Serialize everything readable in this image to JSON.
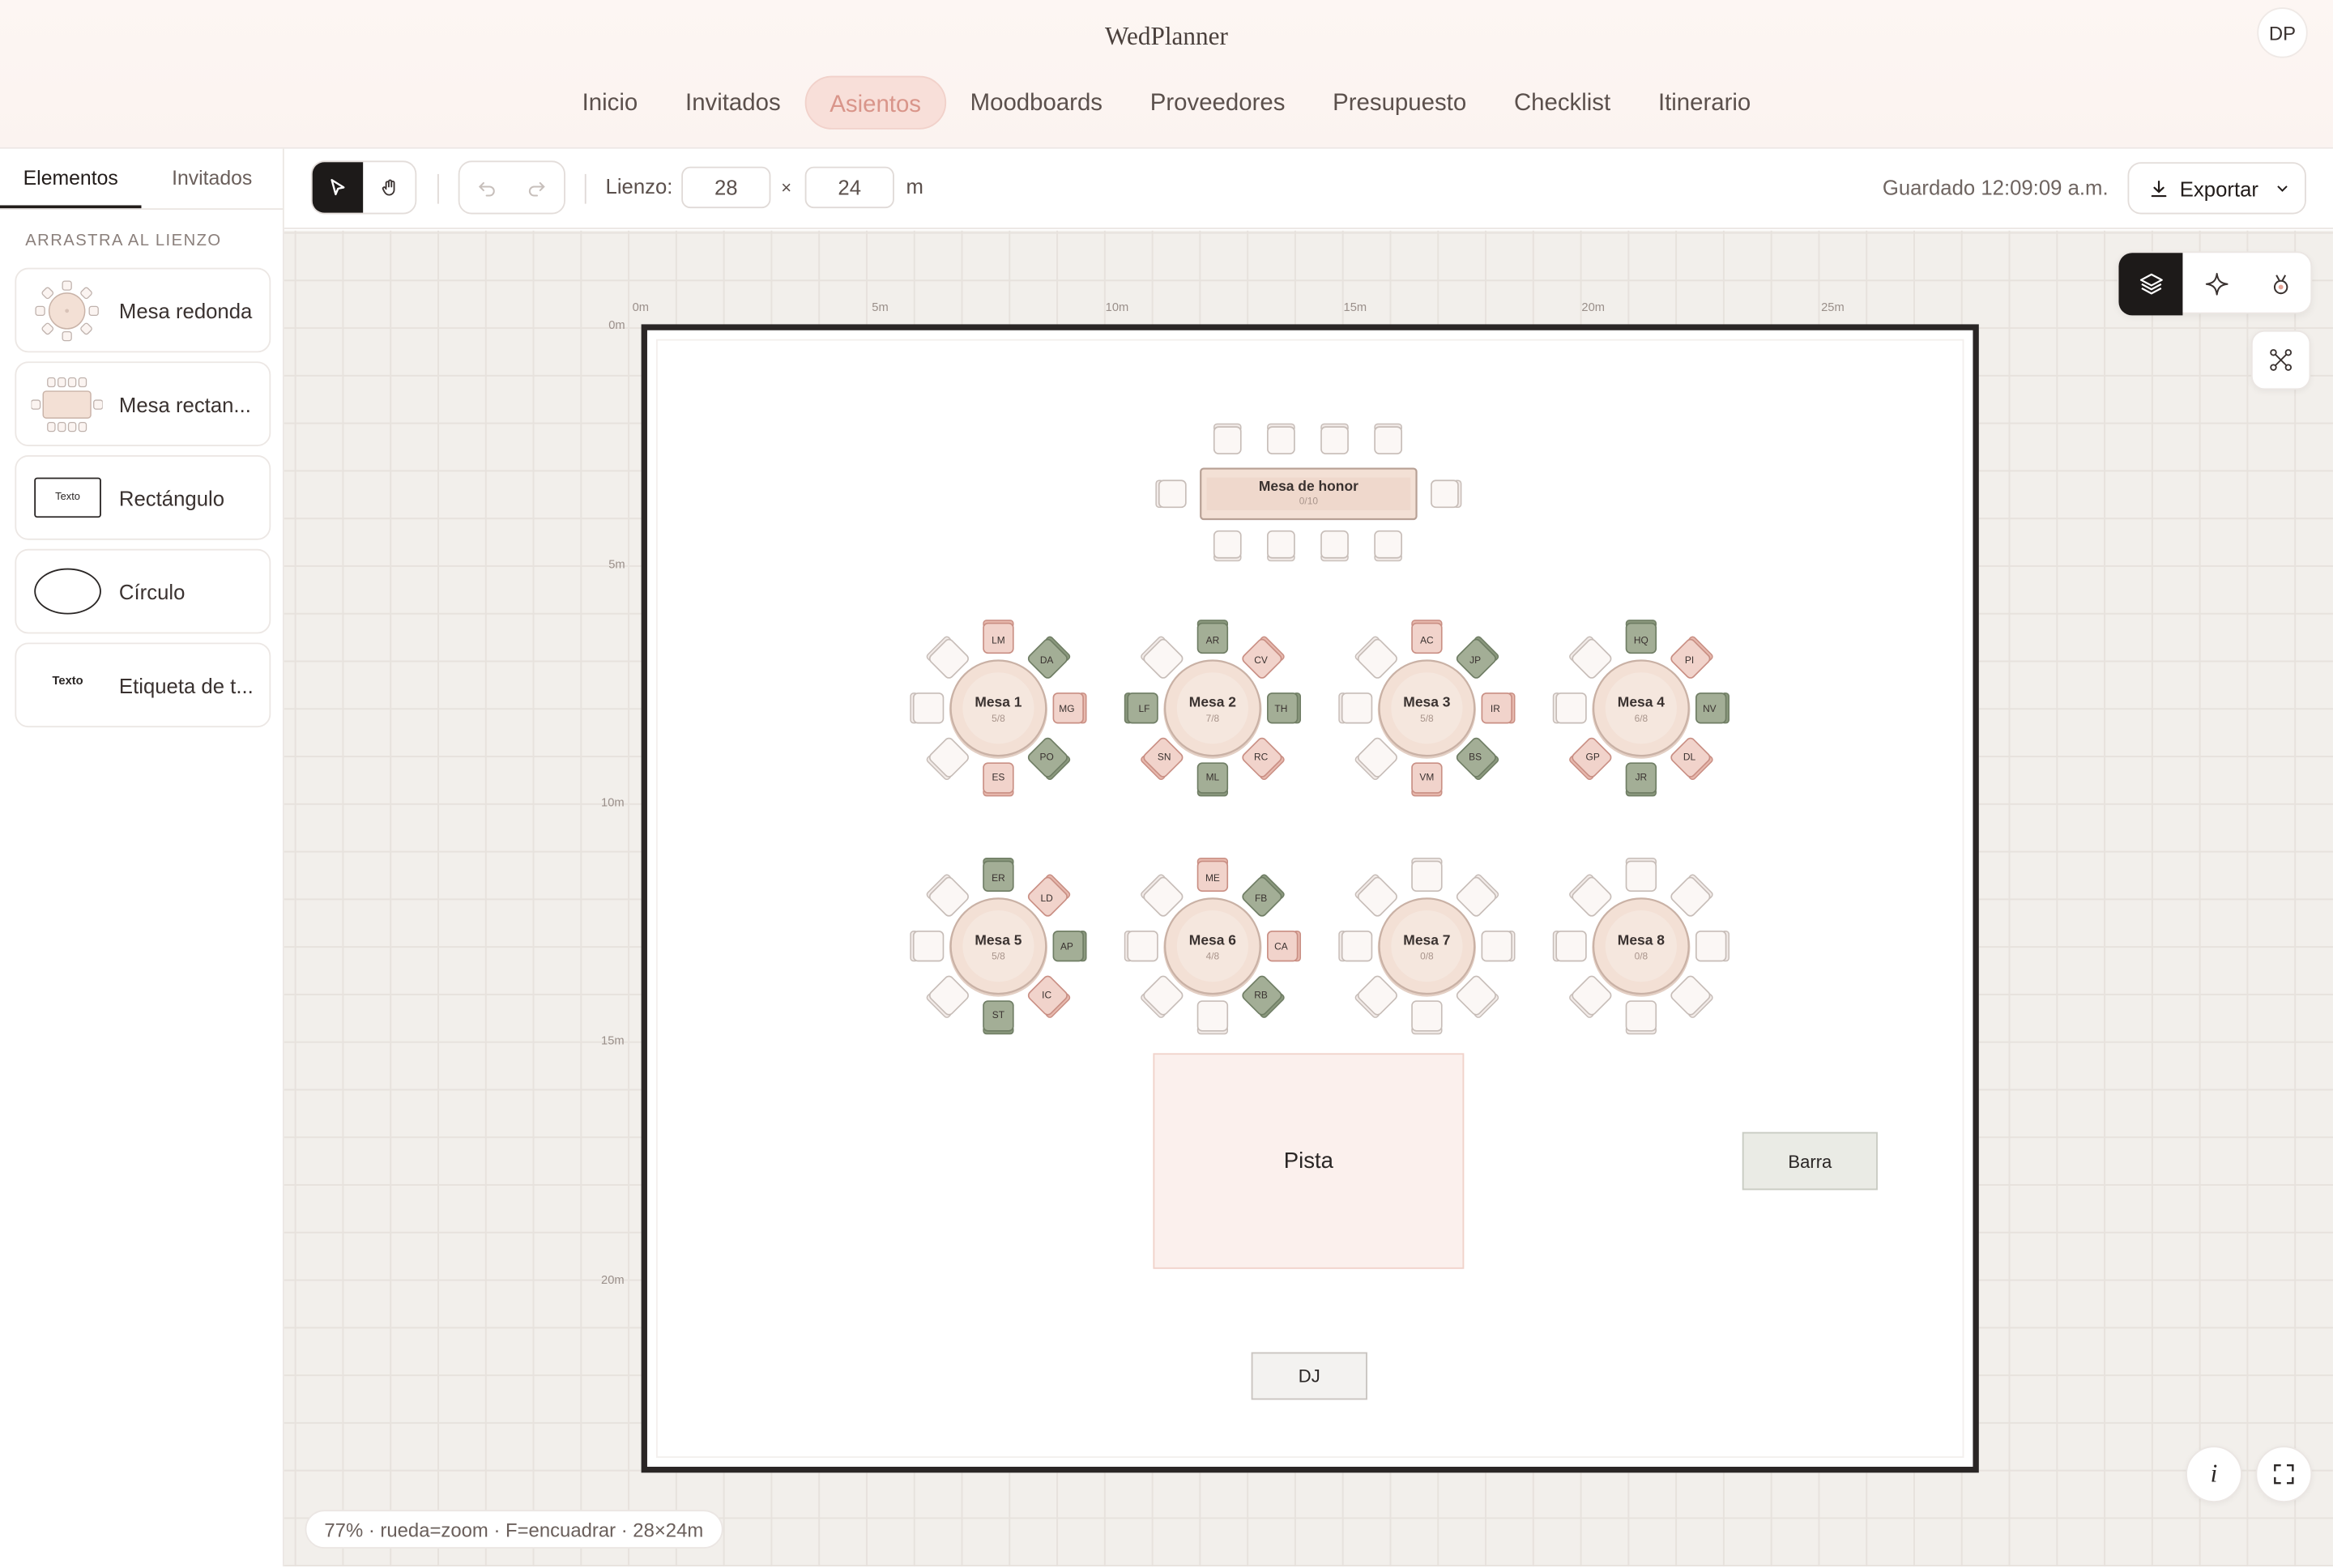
{
  "app": {
    "brand": "WedPlanner",
    "user_initials": "DP"
  },
  "nav": [
    {
      "label": "Inicio"
    },
    {
      "label": "Invitados"
    },
    {
      "label": "Asientos",
      "active": true
    },
    {
      "label": "Moodboards"
    },
    {
      "label": "Proveedores"
    },
    {
      "label": "Presupuesto"
    },
    {
      "label": "Checklist"
    },
    {
      "label": "Itinerario"
    }
  ],
  "sidebar": {
    "tabs": [
      {
        "label": "Elementos",
        "active": true
      },
      {
        "label": "Invitados"
      }
    ],
    "section_title": "ARRASTRA AL LIENZO",
    "items": [
      {
        "label": "Mesa redonda",
        "icon": "round-table-icon"
      },
      {
        "label": "Mesa rectan...",
        "icon": "rect-table-icon"
      },
      {
        "label": "Rectángulo",
        "icon": "rectangle-icon",
        "icon_text": "Texto"
      },
      {
        "label": "Círculo",
        "icon": "circle-shape-icon"
      },
      {
        "label": "Etiqueta de t...",
        "icon": "text-label-icon",
        "icon_text": "Texto"
      }
    ]
  },
  "toolbar": {
    "canvas_label": "Lienzo:",
    "width": "28",
    "times": "×",
    "height": "24",
    "unit": "m",
    "saved": "Guardado 12:09:09 a.m.",
    "export_label": "Exportar"
  },
  "rulers": {
    "x": [
      "0m",
      "5m",
      "10m",
      "15m",
      "20m",
      "25m"
    ],
    "y": [
      "0m",
      "5m",
      "10m",
      "15m",
      "20m"
    ]
  },
  "floorplan": {
    "head_table": {
      "name": "Mesa de honor",
      "count": "0/10"
    },
    "tables": [
      {
        "name": "Mesa 1",
        "count": "5/8",
        "seats": [
          "LM",
          "DA",
          "MG",
          "PO",
          "ES",
          "",
          "",
          ""
        ],
        "colors": [
          "p",
          "g",
          "p",
          "g",
          "p",
          "e",
          "e",
          "e"
        ]
      },
      {
        "name": "Mesa 2",
        "count": "7/8",
        "seats": [
          "AR",
          "CV",
          "TH",
          "RC",
          "ML",
          "SN",
          "LF",
          ""
        ],
        "colors": [
          "g",
          "p",
          "g",
          "p",
          "g",
          "p",
          "g",
          "e"
        ]
      },
      {
        "name": "Mesa 3",
        "count": "5/8",
        "seats": [
          "AC",
          "JP",
          "IR",
          "BS",
          "VM",
          "",
          "",
          ""
        ],
        "colors": [
          "p",
          "g",
          "p",
          "g",
          "p",
          "e",
          "e",
          "e"
        ]
      },
      {
        "name": "Mesa 4",
        "count": "6/8",
        "seats": [
          "HQ",
          "PI",
          "NV",
          "DL",
          "JR",
          "GP",
          "",
          ""
        ],
        "colors": [
          "g",
          "p",
          "g",
          "p",
          "g",
          "p",
          "e",
          "e"
        ]
      },
      {
        "name": "Mesa 5",
        "count": "5/8",
        "seats": [
          "ER",
          "LD",
          "AP",
          "IC",
          "ST",
          "",
          "",
          ""
        ],
        "colors": [
          "g",
          "p",
          "g",
          "p",
          "g",
          "e",
          "e",
          "e"
        ]
      },
      {
        "name": "Mesa 6",
        "count": "4/8",
        "seats": [
          "ME",
          "FB",
          "CA",
          "RB",
          "",
          "",
          "",
          ""
        ],
        "colors": [
          "p",
          "g",
          "p",
          "g",
          "e",
          "e",
          "e",
          "e"
        ]
      },
      {
        "name": "Mesa 7",
        "count": "0/8",
        "seats": [
          "",
          "",
          "",
          "",
          "",
          "",
          "",
          ""
        ],
        "colors": [
          "e",
          "e",
          "e",
          "e",
          "e",
          "e",
          "e",
          "e"
        ]
      },
      {
        "name": "Mesa 8",
        "count": "0/8",
        "seats": [
          "",
          "",
          "",
          "",
          "",
          "",
          "",
          ""
        ],
        "colors": [
          "e",
          "e",
          "e",
          "e",
          "e",
          "e",
          "e",
          "e"
        ]
      }
    ],
    "dance_floor": "Pista",
    "bar": "Barra",
    "dj": "DJ"
  },
  "colors": {
    "accent": "#d9958a",
    "seat_pink": "#f1d3cb",
    "seat_green": "#a3ae96",
    "table_fill": "#f3e0d5"
  },
  "status_bar": "77% · rueda=zoom · F=encuadrar · 28×24m"
}
